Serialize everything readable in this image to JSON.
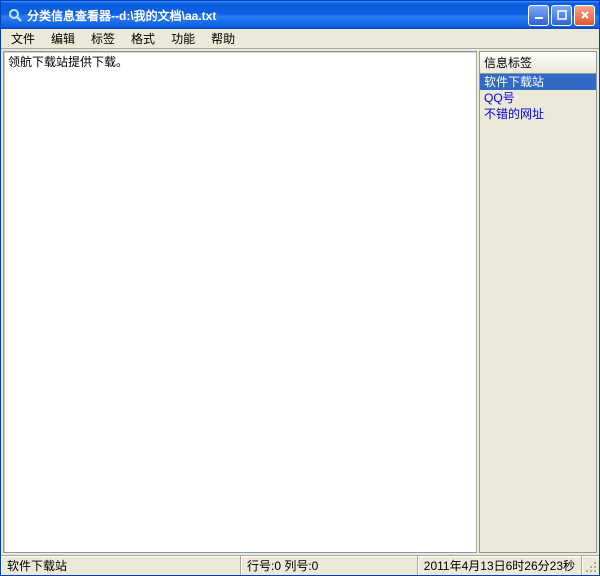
{
  "window": {
    "title": "分类信息查看器--d:\\我的文档\\aa.txt"
  },
  "menu": {
    "file": "文件",
    "edit": "编辑",
    "tag": "标签",
    "format": "格式",
    "function": "功能",
    "help": "帮助"
  },
  "editor": {
    "content": "领航下载站提供下载。"
  },
  "sidebar": {
    "header": "信息标签",
    "items": [
      {
        "label": "软件下载站",
        "selected": true
      },
      {
        "label": "QQ号",
        "selected": false
      },
      {
        "label": "不错的网址",
        "selected": false
      }
    ]
  },
  "status": {
    "left": "软件下载站",
    "mid": "行号:0 列号:0",
    "right": "2011年4月13日6时26分23秒"
  }
}
